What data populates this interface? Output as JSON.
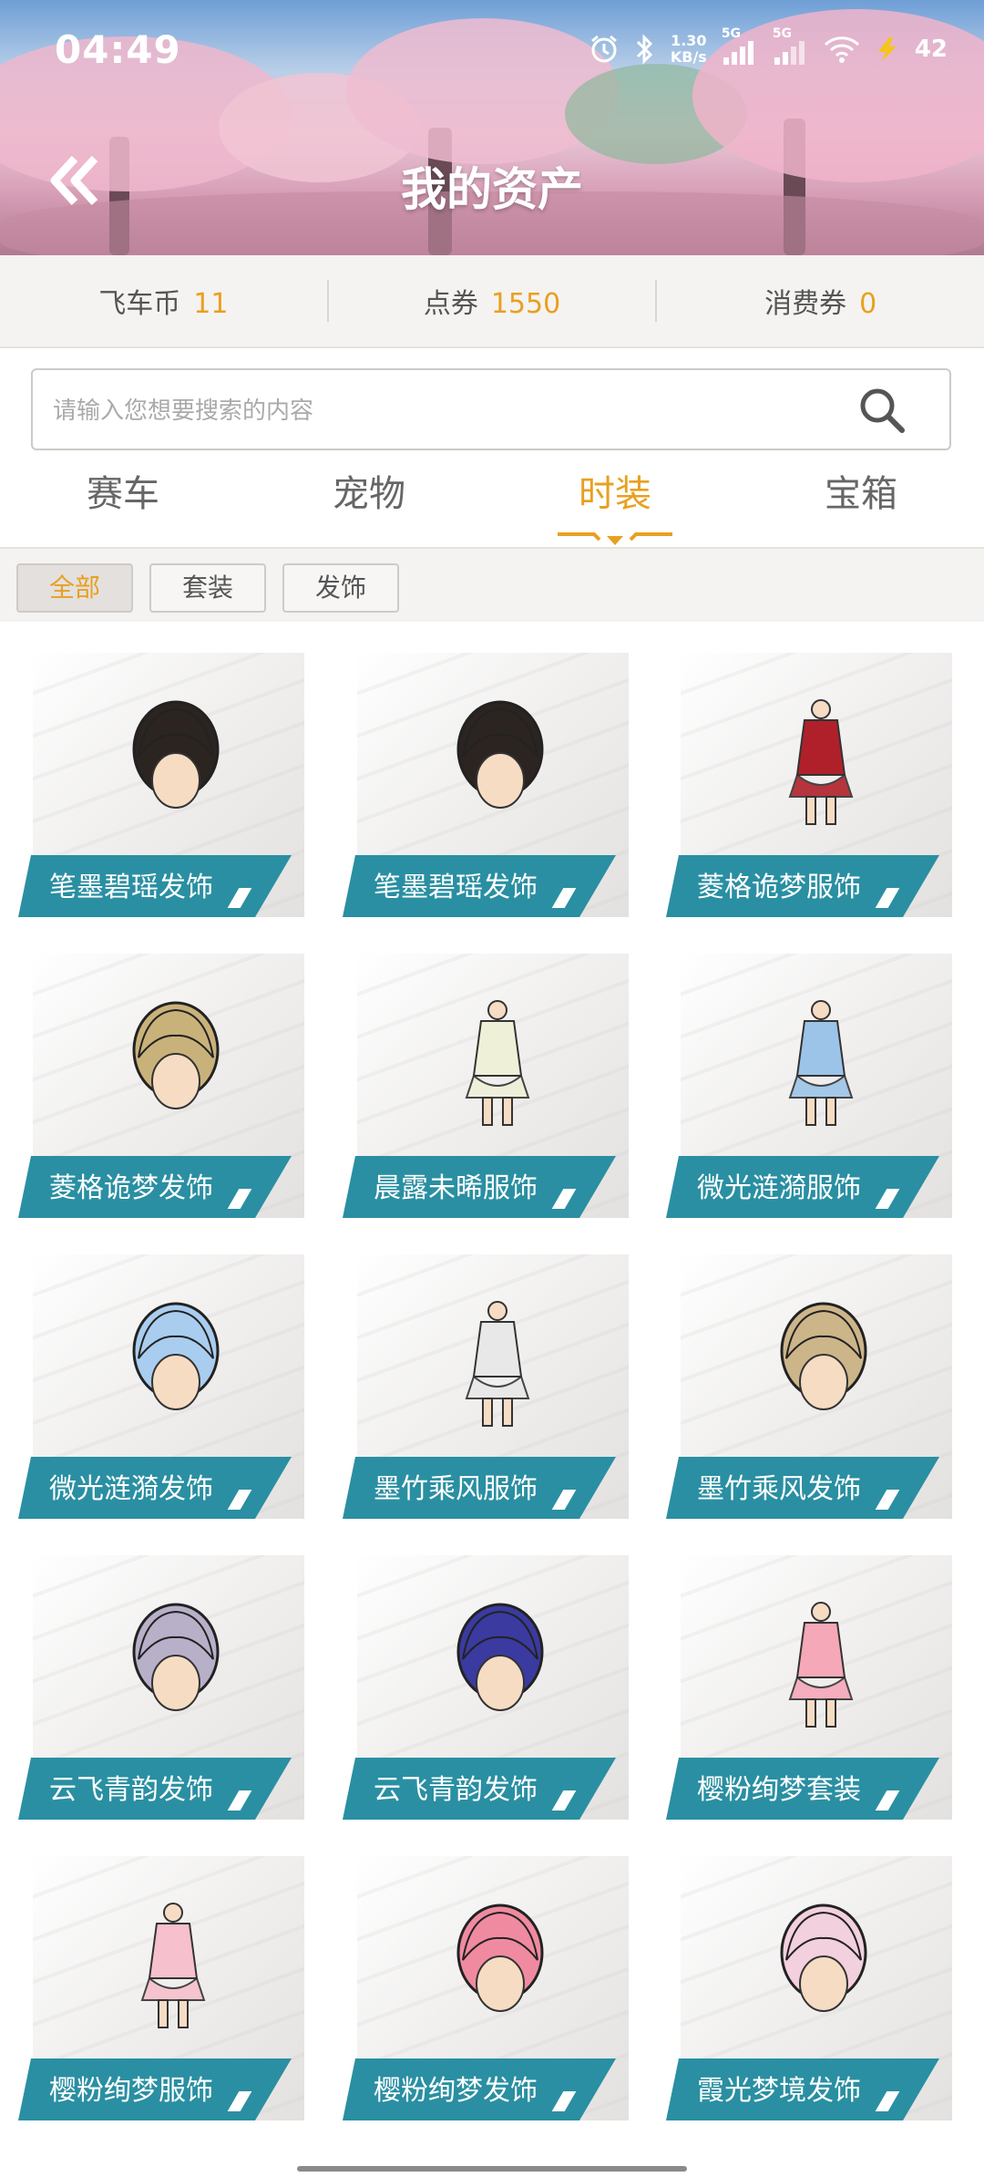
{
  "status_bar": {
    "time": "04:49",
    "network_speed_value": "1.30",
    "network_speed_unit": "KB/s",
    "signal_1": "5G",
    "signal_2": "5G",
    "battery": "42",
    "icons": [
      "alarm-icon",
      "bluetooth-icon",
      "signal-icon",
      "wifi-icon",
      "battery-icon"
    ]
  },
  "header": {
    "title": "我的资产",
    "back_icon": "double-chevron-left-icon"
  },
  "currency": [
    {
      "label": "飞车币",
      "value": "11"
    },
    {
      "label": "点券",
      "value": "1550"
    },
    {
      "label": "消费券",
      "value": "0"
    }
  ],
  "search": {
    "placeholder": "请输入您想要搜索的内容",
    "icon": "search-icon"
  },
  "tabs": [
    {
      "label": "赛车",
      "active": false
    },
    {
      "label": "宠物",
      "active": false
    },
    {
      "label": "时装",
      "active": true
    },
    {
      "label": "宝箱",
      "active": false
    }
  ],
  "filters": [
    {
      "label": "全部",
      "active": true
    },
    {
      "label": "套装",
      "active": false
    },
    {
      "label": "发饰",
      "active": false
    }
  ],
  "items": [
    {
      "name": "笔墨碧瑶发饰",
      "icon": "hair-accessory-icon",
      "color": "#2b2420"
    },
    {
      "name": "笔墨碧瑶发饰",
      "icon": "hair-accessory-icon",
      "color": "#2b2420"
    },
    {
      "name": "菱格诡梦服饰",
      "icon": "outfit-icon",
      "color": "#b0202a"
    },
    {
      "name": "菱格诡梦发饰",
      "icon": "hair-accessory-icon",
      "color": "#c9b27a"
    },
    {
      "name": "晨露未晞服饰",
      "icon": "outfit-icon",
      "color": "#eef0d8"
    },
    {
      "name": "微光涟漪服饰",
      "icon": "outfit-icon",
      "color": "#9cc4e8"
    },
    {
      "name": "微光涟漪发饰",
      "icon": "hair-accessory-icon",
      "color": "#a9cdef"
    },
    {
      "name": "墨竹乘风服饰",
      "icon": "outfit-icon",
      "color": "#e8e8e8"
    },
    {
      "name": "墨竹乘风发饰",
      "icon": "hair-accessory-icon",
      "color": "#cdb58a"
    },
    {
      "name": "云飞青韵发饰",
      "icon": "hair-accessory-icon",
      "color": "#b8b0c8"
    },
    {
      "name": "云飞青韵发饰",
      "icon": "hair-accessory-icon",
      "color": "#3a3aa0"
    },
    {
      "name": "樱粉绚梦套装",
      "icon": "outfit-set-icon",
      "color": "#f5a8b8"
    },
    {
      "name": "樱粉绚梦服饰",
      "icon": "outfit-icon",
      "color": "#f6c0cc"
    },
    {
      "name": "樱粉绚梦发饰",
      "icon": "hair-accessory-icon",
      "color": "#f08aa0"
    },
    {
      "name": "霞光梦境发饰",
      "icon": "hair-accessory-icon",
      "color": "#f2d0de"
    }
  ]
}
